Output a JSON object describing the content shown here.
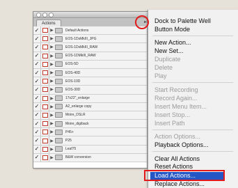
{
  "palette": {
    "tab_label": "Actions",
    "menu_glyph": "▸≡",
    "rows": [
      {
        "label": "Default Actions",
        "expanded": false,
        "checked": true
      },
      {
        "label": "EOS-1DsMkIII_JPG",
        "expanded": false,
        "checked": true
      },
      {
        "label": "EOS-1DsMkIII_RAW",
        "expanded": false,
        "checked": true
      },
      {
        "label": "EOS-1DMkIII_RAW",
        "expanded": false,
        "checked": true
      },
      {
        "label": "EOS-5D",
        "expanded": false,
        "checked": true
      },
      {
        "label": "EOS-40D",
        "expanded": false,
        "checked": true
      },
      {
        "label": "EOS-10D",
        "expanded": false,
        "checked": true
      },
      {
        "label": "EOS-30D",
        "expanded": false,
        "checked": true
      },
      {
        "label": "17x22\"_enlarge",
        "expanded": false,
        "checked": true
      },
      {
        "label": "A2_enlarge copy",
        "expanded": false,
        "checked": true
      },
      {
        "label": "Moire_DSLR",
        "expanded": false,
        "checked": true
      },
      {
        "label": "Moire_digiback",
        "expanded": false,
        "checked": true
      },
      {
        "label": "P45+",
        "expanded": false,
        "checked": true
      },
      {
        "label": "P25",
        "expanded": false,
        "checked": true
      },
      {
        "label": "Leaf75",
        "expanded": false,
        "checked": true
      },
      {
        "label": "B&W conversion",
        "expanded": false,
        "checked": true
      }
    ]
  },
  "menu": {
    "items": [
      {
        "label": "Dock to Palette Well",
        "state": "enabled"
      },
      {
        "label": "Button Mode",
        "state": "enabled"
      },
      {
        "label": "New Action...",
        "state": "enabled"
      },
      {
        "label": "New Set...",
        "state": "enabled"
      },
      {
        "label": "Duplicate",
        "state": "disabled"
      },
      {
        "label": "Delete",
        "state": "disabled"
      },
      {
        "label": "Play",
        "state": "disabled"
      },
      {
        "label": "Start Recording",
        "state": "disabled"
      },
      {
        "label": "Record Again...",
        "state": "disabled"
      },
      {
        "label": "Insert Menu Item...",
        "state": "disabled"
      },
      {
        "label": "Insert Stop...",
        "state": "disabled"
      },
      {
        "label": "Insert Path",
        "state": "disabled"
      },
      {
        "label": "Action Options...",
        "state": "disabled"
      },
      {
        "label": "Playback Options...",
        "state": "enabled"
      },
      {
        "label": "Clear All Actions",
        "state": "enabled"
      },
      {
        "label": "Reset Actions",
        "state": "enabled"
      },
      {
        "label": "Load Actions...",
        "state": "highlighted"
      },
      {
        "label": "Replace Actions...",
        "state": "enabled"
      }
    ]
  },
  "colors": {
    "highlight": "#2456c6",
    "annotation": "#e21a1a"
  }
}
